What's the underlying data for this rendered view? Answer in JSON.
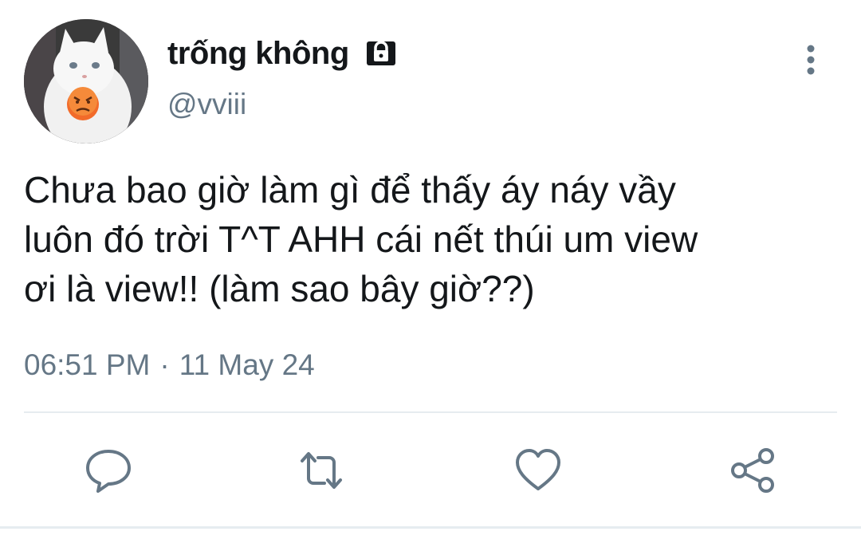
{
  "user": {
    "display_name": "trống không",
    "handle": "@vviii",
    "avatar_icon": "avatar-cat-angry",
    "locked_icon": "lock-icon"
  },
  "tweet": {
    "text": "Chưa bao giờ làm gì để thấy áy náy vầy\nluôn đó trời T^T AHH cái nết thúi um view\nơi là view!! (làm sao bây giờ??)",
    "time": "06:51 PM",
    "separator": "·",
    "date": "11 May 24"
  },
  "actions": [
    {
      "icon": "reply-icon"
    },
    {
      "icon": "retweet-icon"
    },
    {
      "icon": "like-icon"
    },
    {
      "icon": "share-icon"
    }
  ],
  "colors": {
    "text": "#14171a",
    "secondary": "#657786",
    "icon": "#657786",
    "divider": "#e6ecf0"
  }
}
